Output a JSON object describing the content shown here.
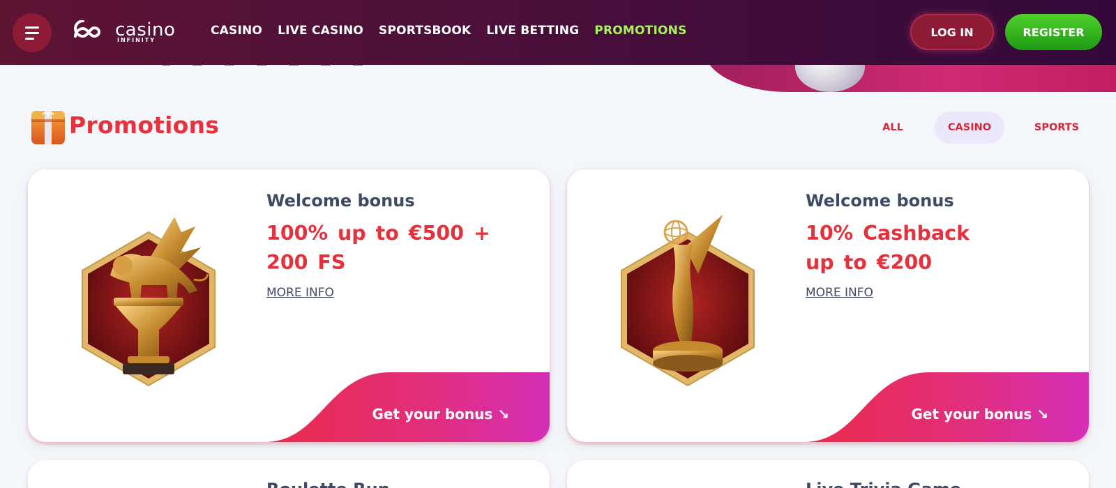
{
  "header": {
    "logo_text": "casino",
    "logo_sub": "INFINITY",
    "nav": [
      "CASINO",
      "LIVE CASINO",
      "SPORTSBOOK",
      "LIVE BETTING",
      "PROMOTIONS"
    ],
    "active_nav": "PROMOTIONS",
    "login_label": "LOG IN",
    "register_label": "REGISTER",
    "colors": {
      "bar": "#4a0f3a",
      "active": "#a6f25c",
      "register": "#2fb41c",
      "login": "#8e1b36"
    }
  },
  "promotions": {
    "title": "Promotions",
    "filters": [
      "ALL",
      "CASINO",
      "SPORTS"
    ],
    "selected_filter": "CASINO",
    "accent": "#e8313c"
  },
  "cards": [
    {
      "label": "Welcome bonus",
      "offer": "100% up to €500 + 200 FS",
      "more_info": "MORE INFO",
      "cta": "Get your bonus ↘",
      "image": "golden-winged-lion-trophy"
    },
    {
      "label": "Welcome bonus",
      "offer": "10% Cashback up to €200",
      "more_info": "MORE INFO",
      "cta": "Get your bonus ↘",
      "image": "golden-award-statuette"
    }
  ],
  "next_cards": [
    "Roulette Run",
    "Live Trivia Game"
  ]
}
